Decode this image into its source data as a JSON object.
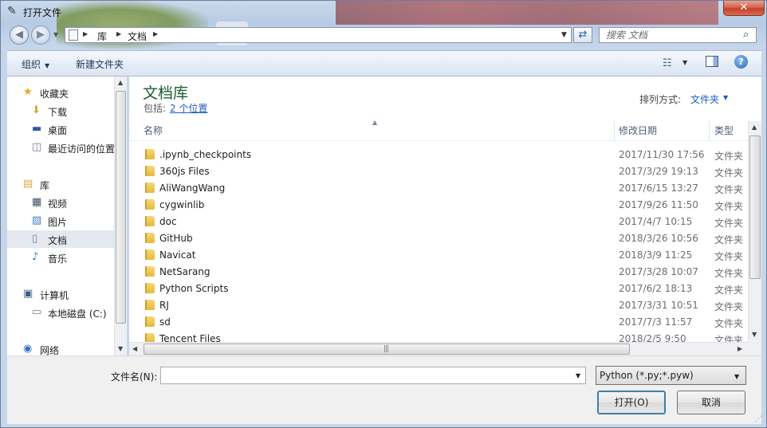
{
  "window": {
    "title": "打开文件",
    "close_glyph": "✕"
  },
  "nav": {
    "back_glyph": "◀",
    "forward_glyph": "▶",
    "recent_glyph": "▼"
  },
  "address": {
    "crumbs": [
      "库",
      "文档"
    ],
    "dropdown_glyph": "▼"
  },
  "search": {
    "placeholder": "搜索 文档",
    "icon": "search-icon"
  },
  "toolbar": {
    "organize_label": "组织",
    "new_folder_label": "新建文件夹",
    "view_icon": "view-options-icon",
    "preview_icon": "preview-pane-icon",
    "help_icon": "help-icon",
    "help_glyph": "?"
  },
  "sidebar": {
    "items": [
      {
        "label": "收藏夹",
        "icon": "star-icon",
        "group": true
      },
      {
        "label": "下载",
        "icon": "download-folder-icon",
        "group": false
      },
      {
        "label": "桌面",
        "icon": "desktop-icon",
        "group": false
      },
      {
        "label": "最近访问的位置",
        "icon": "recent-places-icon",
        "group": false
      },
      {
        "label": "库",
        "icon": "libraries-icon",
        "group": true
      },
      {
        "label": "视频",
        "icon": "video-library-icon",
        "group": false
      },
      {
        "label": "图片",
        "icon": "picture-library-icon",
        "group": false
      },
      {
        "label": "文档",
        "icon": "document-library-icon",
        "group": false,
        "selected": true
      },
      {
        "label": "音乐",
        "icon": "music-library-icon",
        "group": false
      },
      {
        "label": "计算机",
        "icon": "computer-icon",
        "group": true
      },
      {
        "label": "本地磁盘 (C:)",
        "icon": "local-disk-icon",
        "group": false
      },
      {
        "label": "网络",
        "icon": "network-icon",
        "group": true
      }
    ]
  },
  "library": {
    "title": "文档库",
    "includes_label": "包括:",
    "locations_link": "2 个位置",
    "arrange_label": "排列方式:",
    "arrange_value": "文件夹"
  },
  "columns": {
    "name": "名称",
    "modified": "修改日期",
    "type": "类型"
  },
  "files": [
    {
      "name": ".ipynb_checkpoints",
      "modified": "2017/11/30 17:56",
      "type": "文件夹"
    },
    {
      "name": "360js Files",
      "modified": "2017/3/29 19:13",
      "type": "文件夹"
    },
    {
      "name": "AliWangWang",
      "modified": "2017/6/15 13:27",
      "type": "文件夹"
    },
    {
      "name": "cygwinlib",
      "modified": "2017/9/26 11:50",
      "type": "文件夹"
    },
    {
      "name": "doc",
      "modified": "2017/4/7 10:15",
      "type": "文件夹"
    },
    {
      "name": "GitHub",
      "modified": "2018/3/26 10:56",
      "type": "文件夹"
    },
    {
      "name": "Navicat",
      "modified": "2018/3/9 11:25",
      "type": "文件夹"
    },
    {
      "name": "NetSarang",
      "modified": "2017/3/28 10:07",
      "type": "文件夹"
    },
    {
      "name": "Python Scripts",
      "modified": "2017/6/2 18:13",
      "type": "文件夹"
    },
    {
      "name": "RJ",
      "modified": "2017/3/31 10:51",
      "type": "文件夹"
    },
    {
      "name": "sd",
      "modified": "2017/7/3 11:57",
      "type": "文件夹"
    },
    {
      "name": "Tencent Files",
      "modified": "2018/2/5 9:50",
      "type": "文件夹"
    }
  ],
  "footer": {
    "filename_label": "文件名(N):",
    "filename_value": "",
    "filetype_value": "Python (*.py;*.pyw)",
    "open_label": "打开(O)",
    "cancel_label": "取消"
  },
  "colors": {
    "accent_link": "#1c5fb8",
    "library_title": "#1d5d2f",
    "folder": "#e8b83c",
    "close_button": "#c7412a"
  }
}
